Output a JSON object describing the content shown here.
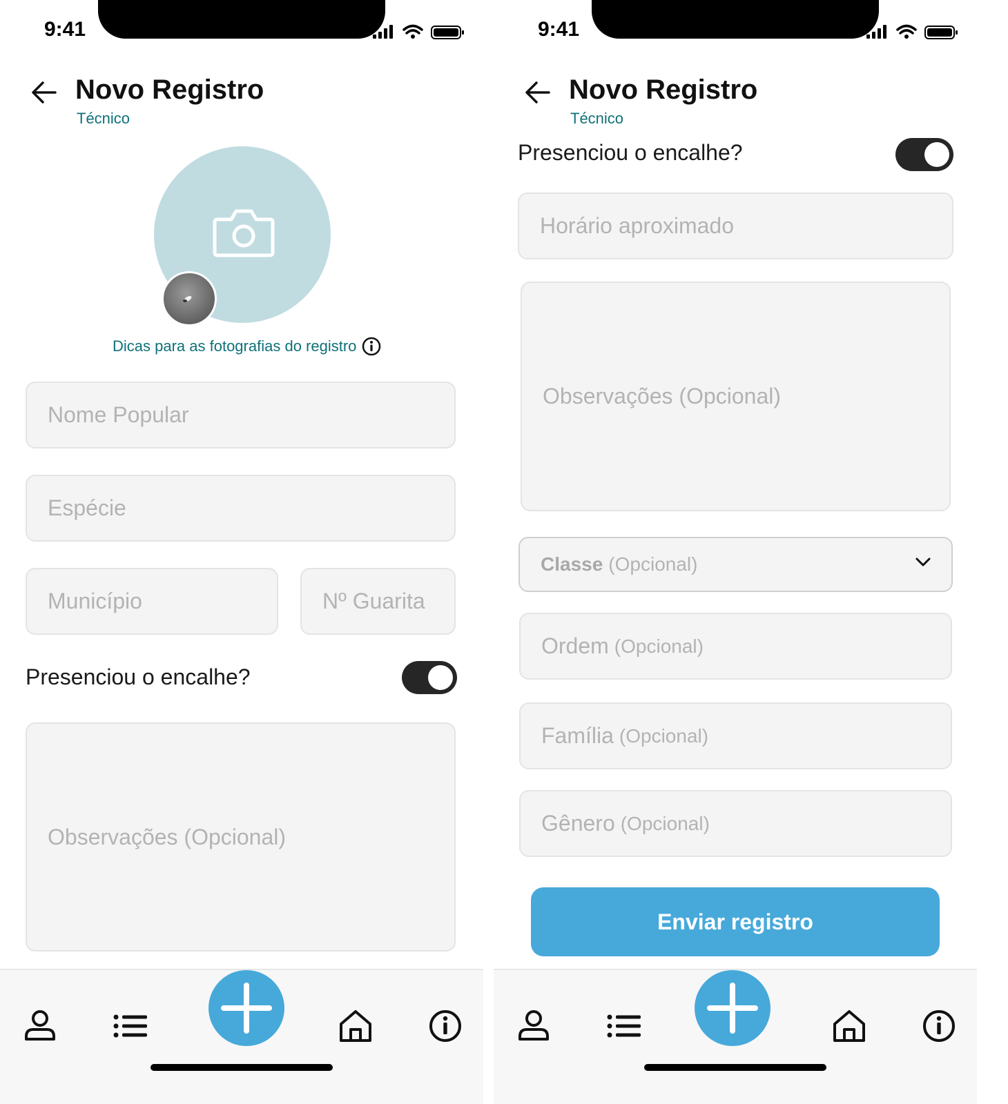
{
  "status_bar": {
    "time": "9:41"
  },
  "header": {
    "title": "Novo Registro",
    "subtitle": "Técnico"
  },
  "photo": {
    "tips_label": "Dicas para as fotografias do registro"
  },
  "form": {
    "nome_popular_placeholder": "Nome Popular",
    "especie_placeholder": "Espécie",
    "municipio_placeholder": "Município",
    "guarita_placeholder": "Nº Guarita",
    "presenciou_label": "Presenciou o encalhe?",
    "presenciou_on": true,
    "horario_placeholder": "Horário aproximado",
    "observacoes_placeholder": "Observações (Opcional)",
    "classe_label": "Classe",
    "ordem_label": "Ordem",
    "familia_label": "Família",
    "genero_label": "Gênero",
    "optional_suffix": "(Opcional)",
    "submit_label": "Enviar registro"
  },
  "tabbar": {
    "items": [
      "profile-icon",
      "list-icon",
      "add-icon",
      "home-icon",
      "info-icon"
    ],
    "accent": "#47a9da"
  },
  "colors": {
    "accent": "#47a9da",
    "teal_text": "#0e7178",
    "photo_bg": "#c0dce0",
    "toggle_on": "#262626"
  }
}
